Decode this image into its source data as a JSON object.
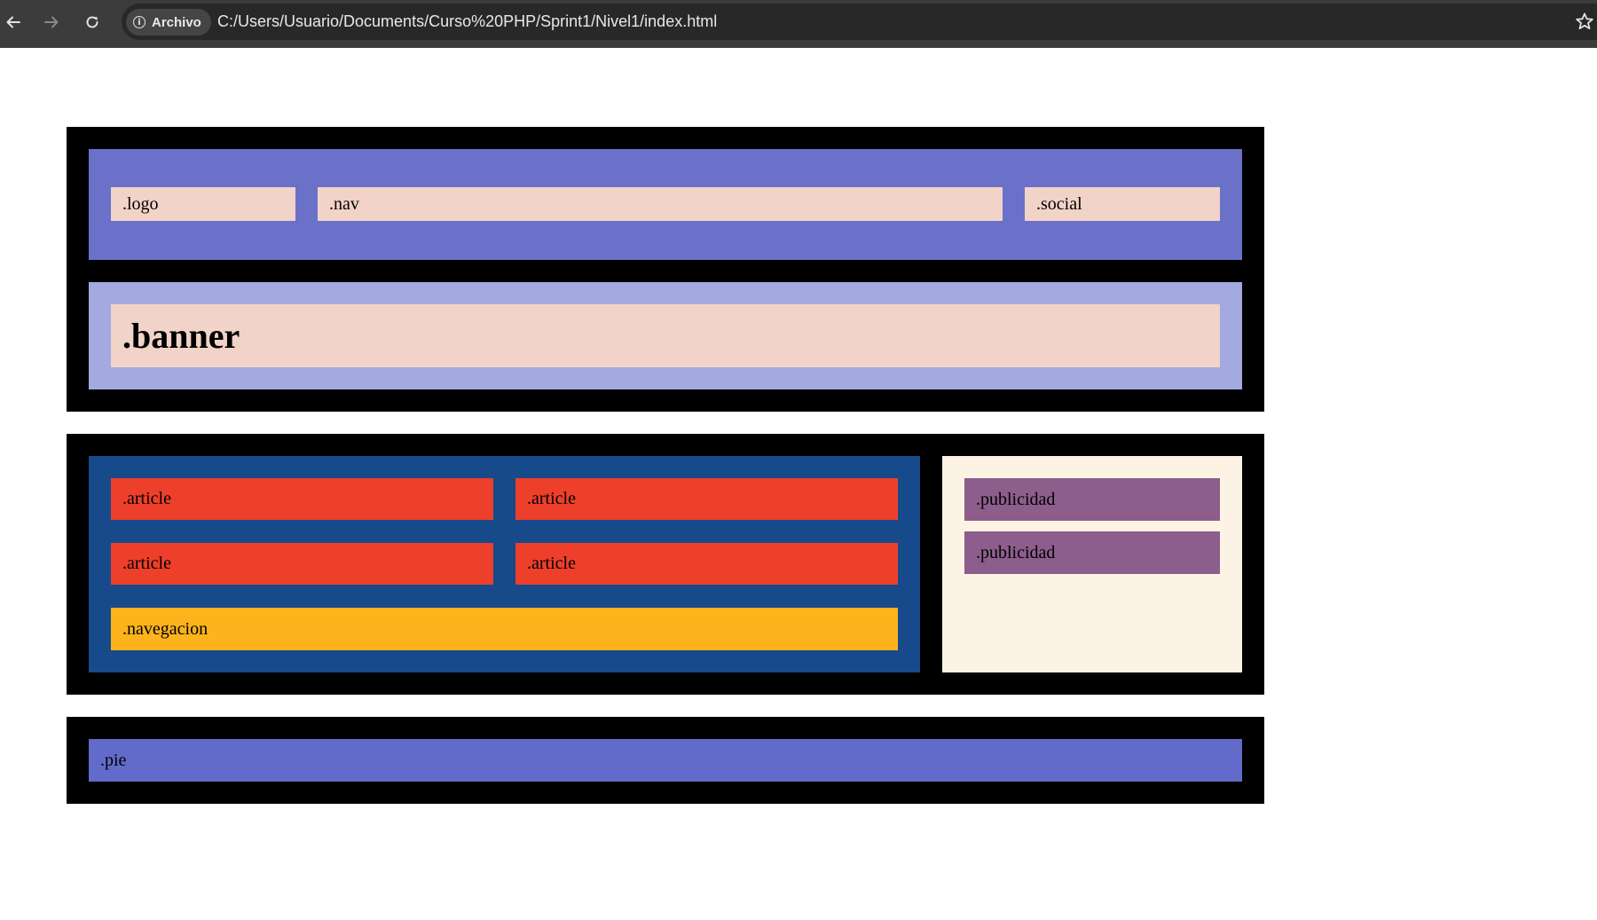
{
  "browser": {
    "scheme_chip": "Archivo",
    "url": "C:/Users/Usuario/Documents/Curso%20PHP/Sprint1/Nivel1/index.html"
  },
  "colors": {
    "chrome_bg": "#3c3c3c",
    "header_bar": "#6b70c9",
    "header_cells": "#f2d3c8",
    "banner_bar": "#a4a9e0",
    "content_bar": "#174a8a",
    "article": "#ee3f2a",
    "navegacion": "#fdb31b",
    "aside_bar": "#fdf3e4",
    "publicidad": "#8d5d8c",
    "pie": "#636bca",
    "container": "#000000"
  },
  "header": {
    "logo": ".logo",
    "nav": ".nav",
    "social": ".social",
    "banner": ".banner"
  },
  "main": {
    "articles": [
      ".article",
      ".article",
      ".article",
      ".article"
    ],
    "navegacion": ".navegacion",
    "publicidad": [
      ".publicidad",
      ".publicidad"
    ]
  },
  "footer": {
    "pie": ".pie"
  }
}
